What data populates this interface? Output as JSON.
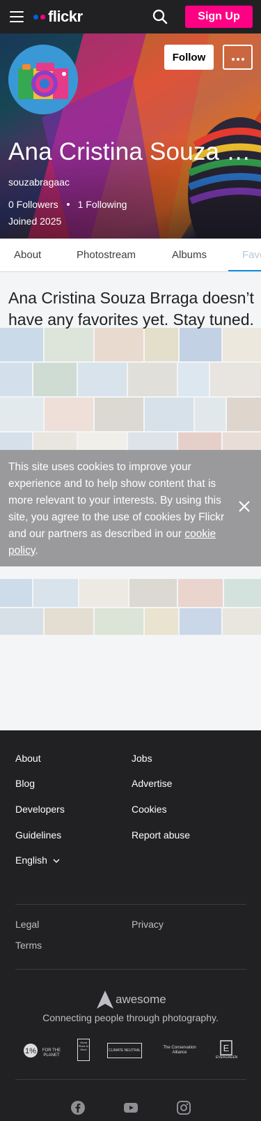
{
  "header": {
    "logo_text": "flickr",
    "signup_label": "Sign Up"
  },
  "profile": {
    "name": "Ana Cristina Souza Brraga",
    "username": "souzabragaac",
    "followers": "0 Followers",
    "following": "1 Following",
    "joined": "Joined 2025",
    "follow_label": "Follow"
  },
  "tabs": [
    {
      "label": "About"
    },
    {
      "label": "Photostream"
    },
    {
      "label": "Albums"
    },
    {
      "label": "Faves"
    }
  ],
  "empty_state": {
    "message": "Ana Cristina Souza Brraga doesn’t have any favorites yet. Stay tuned."
  },
  "cookie_banner": {
    "text": "This site uses cookies to improve your experience and to help show content that is more relevant to your interests. By using this site, you agree to the use of cookies by Flickr and our partners as described in our ",
    "link_label": "cookie policy",
    "suffix": "."
  },
  "footer": {
    "links_col1": [
      "About",
      "Blog",
      "Developers",
      "Guidelines"
    ],
    "links_col2": [
      "Jobs",
      "Advertise",
      "Cookies",
      "Report abuse"
    ],
    "language": "English",
    "legal": "Legal",
    "privacy": "Privacy",
    "terms": "Terms",
    "brand": "awesome",
    "tagline": "Connecting people through photography.",
    "badges": [
      "FOR THE PLANET",
      "Great Place to Work",
      "CLIMATE NEUTRAL",
      "The Conservation Alliance",
      "EVERGREEN"
    ]
  },
  "colors": {
    "brand_pink": "#ff0084",
    "brand_blue": "#0063dc",
    "tab_underline": "#128fdc",
    "footer_bg": "#212124"
  },
  "icons": [
    "hamburger-icon",
    "search-icon",
    "more-icon",
    "close-icon",
    "chevron-down-icon",
    "facebook-icon",
    "youtube-icon",
    "instagram-icon"
  ]
}
